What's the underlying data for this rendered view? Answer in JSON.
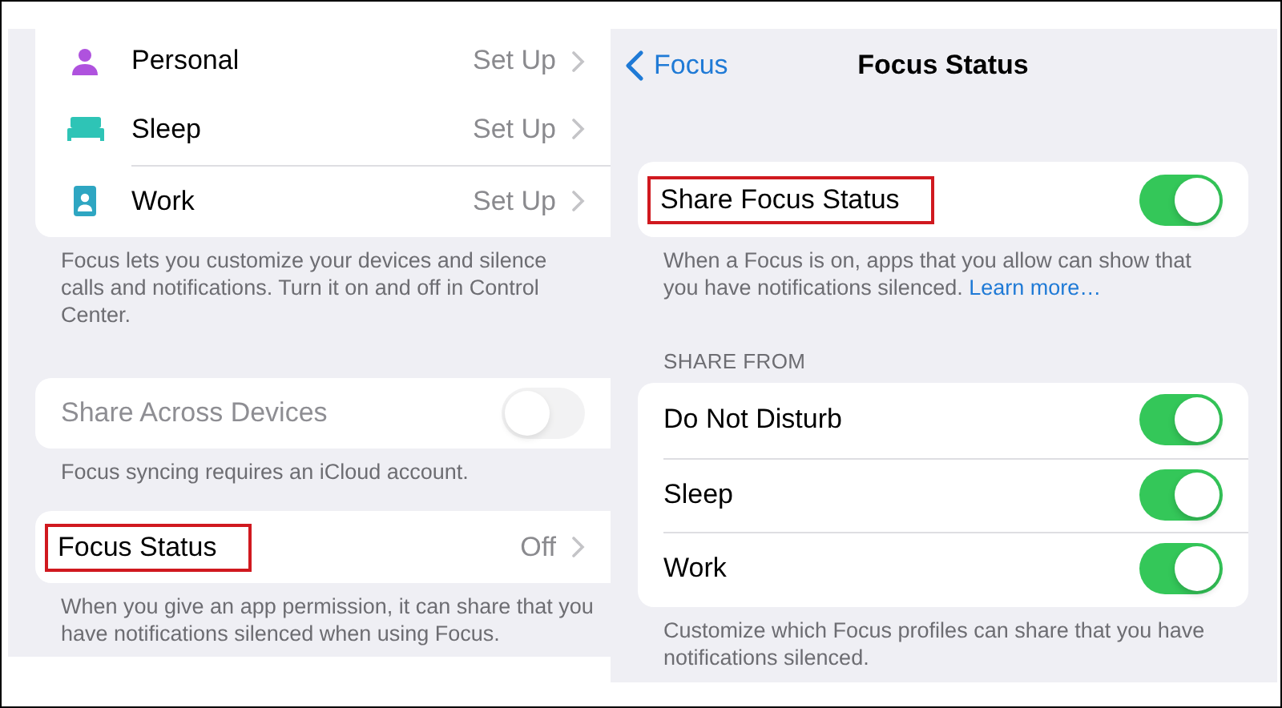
{
  "left_screen": {
    "focus_modes": [
      {
        "kind": "person",
        "name": "Personal",
        "value": "Set Up"
      },
      {
        "kind": "bed",
        "name": "Sleep",
        "value": "Set Up"
      },
      {
        "kind": "badge",
        "name": "Work",
        "value": "Set Up"
      }
    ],
    "focus_modes_footer": "Focus lets you customize your devices and silence calls and notifications. Turn it on and off in Control Center.",
    "share_across_devices": {
      "label": "Share Across Devices",
      "on": false,
      "disabled": true
    },
    "share_across_devices_footer": "Focus syncing requires an iCloud account.",
    "focus_status": {
      "label": "Focus Status",
      "value": "Off",
      "highlighted": true
    },
    "focus_status_footer": "When you give an app permission, it can share that you have notifications silenced when using Focus."
  },
  "right_screen": {
    "back_button": "Focus",
    "title": "Focus Status",
    "share_focus_status": {
      "label": "Share Focus Status",
      "on": true,
      "highlighted": true
    },
    "share_focus_status_footer": {
      "text": "When a Focus is on, apps that you allow can show that you have notifications silenced.",
      "link": "Learn more…"
    },
    "section_header": "SHARE FROM",
    "share_from": [
      {
        "label": "Do Not Disturb",
        "on": true
      },
      {
        "label": "Sleep",
        "on": true
      },
      {
        "label": "Work",
        "on": true
      }
    ],
    "share_from_footer": "Customize which Focus profiles can share that you have notifications silenced."
  }
}
